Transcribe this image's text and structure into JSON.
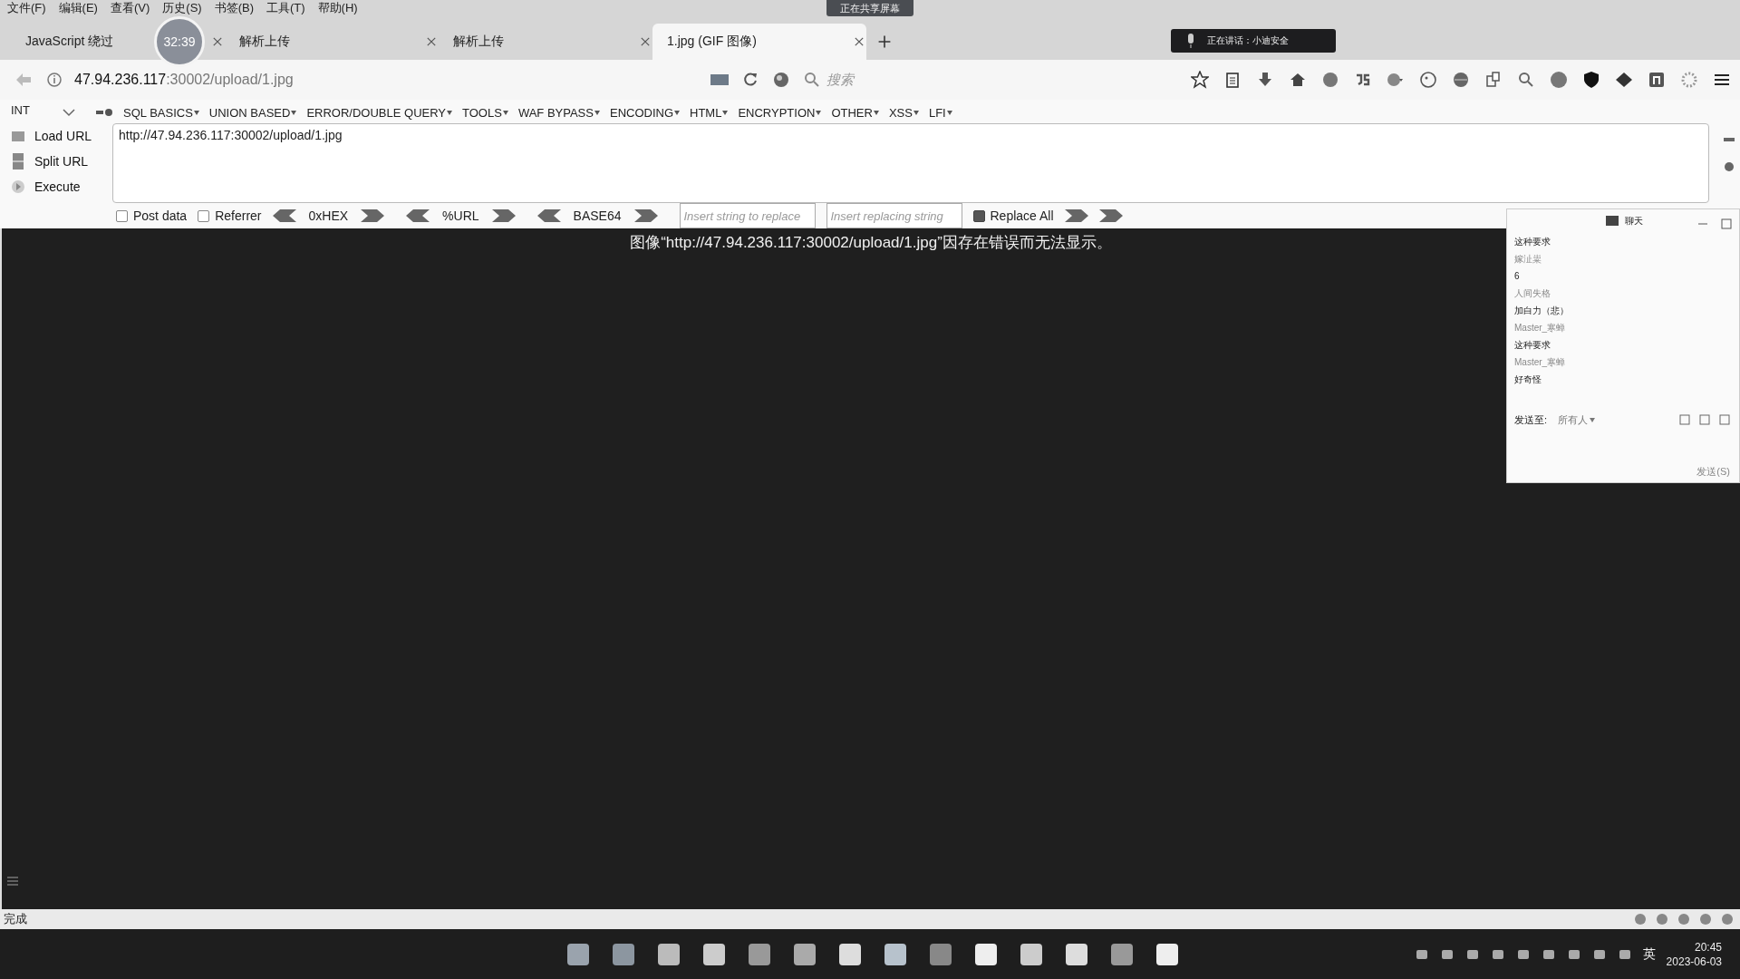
{
  "menu_bar": [
    "文件(F)",
    "编辑(E)",
    "查看(V)",
    "历史(S)",
    "书签(B)",
    "工具(T)",
    "帮助(H)"
  ],
  "recording_timer": "32:39",
  "sharing_banner": "正在共享屏幕",
  "speaking_banner": "正在讲话：小迪安全",
  "tabs": [
    {
      "label": "JavaScript 绕过",
      "selected": false
    },
    {
      "label": "解析上传",
      "selected": false
    },
    {
      "label": "解析上传",
      "selected": false
    },
    {
      "label": "1.jpg (GIF 图像)",
      "selected": true
    }
  ],
  "address": {
    "host": "47.94.236.117",
    "path": ":30002/upload/1.jpg"
  },
  "search": {
    "placeholder": "搜索"
  },
  "hackbar": {
    "select": "INT",
    "menus": [
      "SQL BASICS",
      "UNION BASED",
      "ERROR/DOUBLE QUERY",
      "TOOLS",
      "WAF BYPASS",
      "ENCODING",
      "HTML",
      "ENCRYPTION",
      "OTHER",
      "XSS",
      "LFI"
    ],
    "actions": [
      "Load URL",
      "Split URL",
      "Execute"
    ],
    "url": "http://47.94.236.117:30002/upload/1.jpg",
    "options": [
      {
        "kind": "checkbox",
        "label": "Post data",
        "checked": false
      },
      {
        "kind": "checkbox",
        "label": "Referrer",
        "checked": false
      },
      {
        "kind": "encoder",
        "label": "0xHEX"
      },
      {
        "kind": "encoder",
        "label": "%URL"
      },
      {
        "kind": "encoder",
        "label": "BASE64"
      },
      {
        "kind": "field",
        "placeholder": "Insert string to replace"
      },
      {
        "kind": "field",
        "placeholder": "Insert replacing string"
      },
      {
        "kind": "checkbox",
        "label": "Replace All",
        "checked": true
      }
    ]
  },
  "content": {
    "message": "图像“http://47.94.236.117:30002/upload/1.jpg”因存在错误而无法显示。"
  },
  "chat": {
    "title": "聊天",
    "messages": [
      {
        "kind": "text",
        "text": "这种要求"
      },
      {
        "kind": "sender",
        "text": "嫁沚粜"
      },
      {
        "kind": "text",
        "text": "6"
      },
      {
        "kind": "sender",
        "text": "人间失格"
      },
      {
        "kind": "text",
        "text": "加白力（悲）"
      },
      {
        "kind": "sender",
        "text": "Master_寒蝉"
      },
      {
        "kind": "text",
        "text": "这种要求"
      },
      {
        "kind": "sender",
        "text": "Master_寒蝉"
      },
      {
        "kind": "text",
        "text": "好奇怪"
      }
    ],
    "send_to_label": "发送至:",
    "recipient": "所有人",
    "send_button": "发送(S)"
  },
  "status_bar": "完成",
  "taskbar": {
    "ime": "英",
    "time": "20:45",
    "date": "2023-06-03"
  }
}
